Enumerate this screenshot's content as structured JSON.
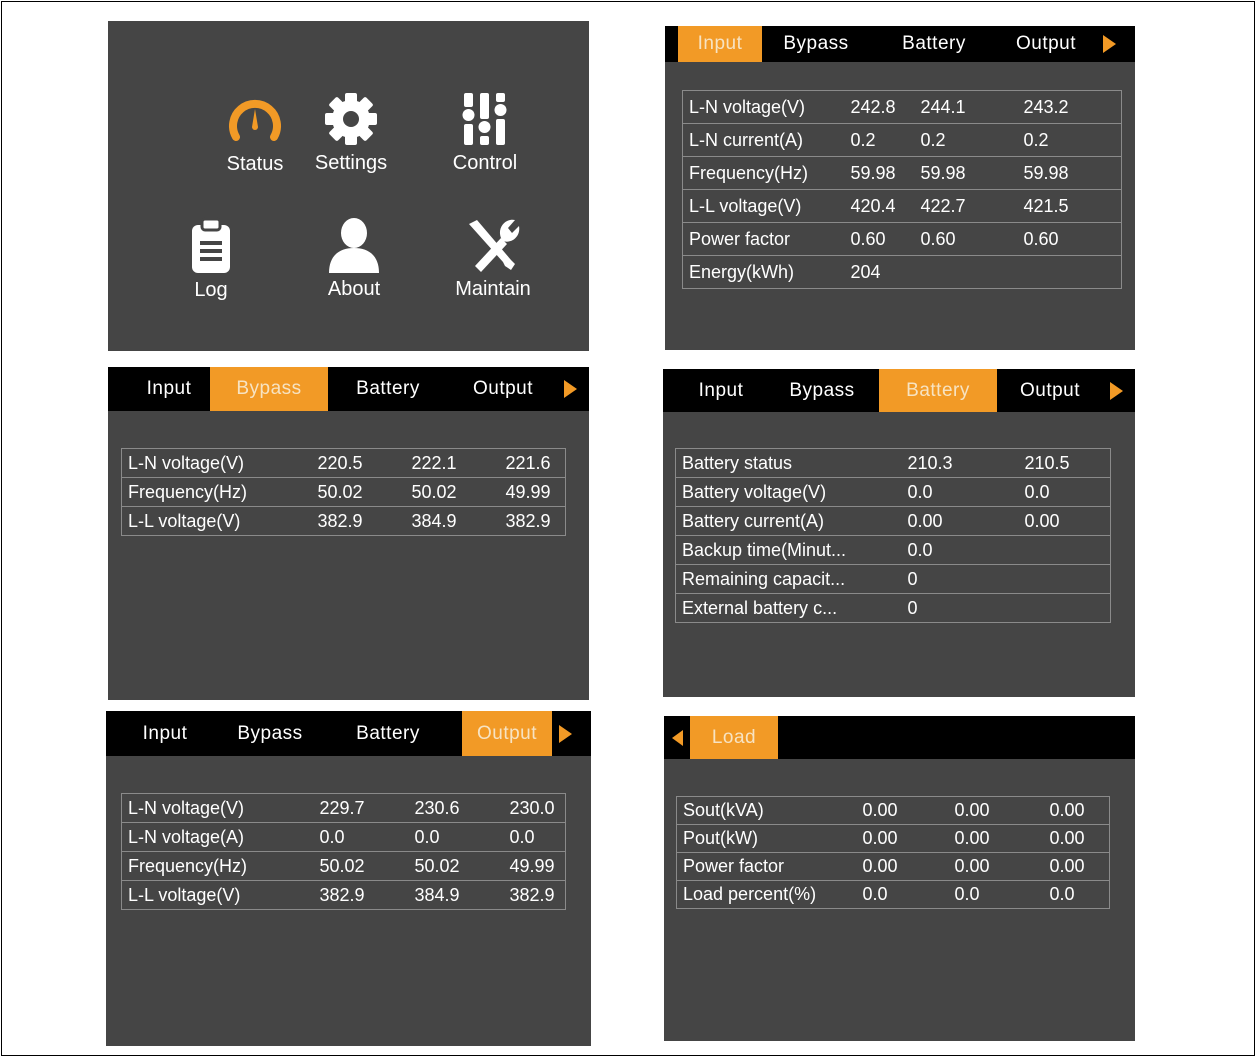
{
  "colors": {
    "accent": "#f29a26",
    "screen_bg": "#454545",
    "tabbar_bg": "#000000"
  },
  "menu": {
    "items": [
      {
        "label": "Status",
        "icon": "gauge-icon"
      },
      {
        "label": "Settings",
        "icon": "gear-icon"
      },
      {
        "label": "Control",
        "icon": "sliders-icon"
      },
      {
        "label": "Log",
        "icon": "clipboard-icon"
      },
      {
        "label": "About",
        "icon": "user-icon"
      },
      {
        "label": "Maintain",
        "icon": "tools-icon"
      }
    ]
  },
  "tabs": {
    "input": "Input",
    "bypass": "Bypass",
    "battery": "Battery",
    "output": "Output",
    "load": "Load"
  },
  "input_screen": {
    "rows": [
      {
        "label": "L-N voltage(V)",
        "v1": "242.8",
        "v2": "244.1",
        "v3": "243.2"
      },
      {
        "label": "L-N current(A)",
        "v1": "0.2",
        "v2": "0.2",
        "v3": "0.2"
      },
      {
        "label": "Frequency(Hz)",
        "v1": "59.98",
        "v2": "59.98",
        "v3": "59.98"
      },
      {
        "label": "L-L voltage(V)",
        "v1": "420.4",
        "v2": "422.7",
        "v3": "421.5"
      },
      {
        "label": "Power factor",
        "v1": "0.60",
        "v2": "0.60",
        "v3": "0.60"
      },
      {
        "label": "Energy(kWh)",
        "v1": "204",
        "v2": "",
        "v3": ""
      }
    ]
  },
  "bypass_screen": {
    "rows": [
      {
        "label": "L-N voltage(V)",
        "v1": "220.5",
        "v2": "222.1",
        "v3": "221.6"
      },
      {
        "label": "Frequency(Hz)",
        "v1": "50.02",
        "v2": "50.02",
        "v3": "49.99"
      },
      {
        "label": "L-L voltage(V)",
        "v1": "382.9",
        "v2": "384.9",
        "v3": "382.9"
      }
    ]
  },
  "battery_screen": {
    "rows": [
      {
        "label": "Battery status",
        "v1": "210.3",
        "v2": "210.5"
      },
      {
        "label": "Battery voltage(V)",
        "v1": "0.0",
        "v2": "0.0"
      },
      {
        "label": "Battery current(A)",
        "v1": "0.00",
        "v2": "0.00"
      },
      {
        "label": "Backup time(Minut...",
        "v1": "0.0",
        "v2": ""
      },
      {
        "label": "Remaining capacit...",
        "v1": "0",
        "v2": ""
      },
      {
        "label": "External battery c...",
        "v1": "0",
        "v2": ""
      }
    ]
  },
  "output_screen": {
    "rows": [
      {
        "label": "L-N voltage(V)",
        "v1": "229.7",
        "v2": "230.6",
        "v3": "230.0"
      },
      {
        "label": "L-N voltage(A)",
        "v1": "0.0",
        "v2": "0.0",
        "v3": "0.0"
      },
      {
        "label": "Frequency(Hz)",
        "v1": "50.02",
        "v2": "50.02",
        "v3": "49.99"
      },
      {
        "label": "L-L voltage(V)",
        "v1": "382.9",
        "v2": "384.9",
        "v3": "382.9"
      }
    ]
  },
  "load_screen": {
    "rows": [
      {
        "label": "Sout(kVA)",
        "v1": "0.00",
        "v2": "0.00",
        "v3": "0.00"
      },
      {
        "label": "Pout(kW)",
        "v1": "0.00",
        "v2": "0.00",
        "v3": "0.00"
      },
      {
        "label": "Power factor",
        "v1": "0.00",
        "v2": "0.00",
        "v3": "0.00"
      },
      {
        "label": "Load percent(%)",
        "v1": "0.0",
        "v2": "0.0",
        "v3": "0.0"
      }
    ]
  }
}
